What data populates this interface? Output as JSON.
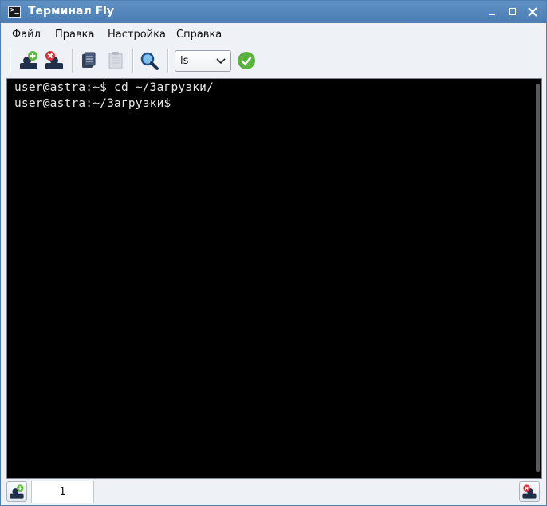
{
  "window": {
    "title": "Терминал Fly"
  },
  "menu": {
    "items": [
      "Файл",
      "Правка",
      "Настройка",
      "Справка"
    ]
  },
  "toolbar": {
    "command_value": "ls"
  },
  "terminal": {
    "lines": [
      "user@astra:~$ cd ~/Загрузки/",
      "user@astra:~/Загрузки$"
    ]
  },
  "tabs": [
    {
      "label": "1"
    }
  ]
}
